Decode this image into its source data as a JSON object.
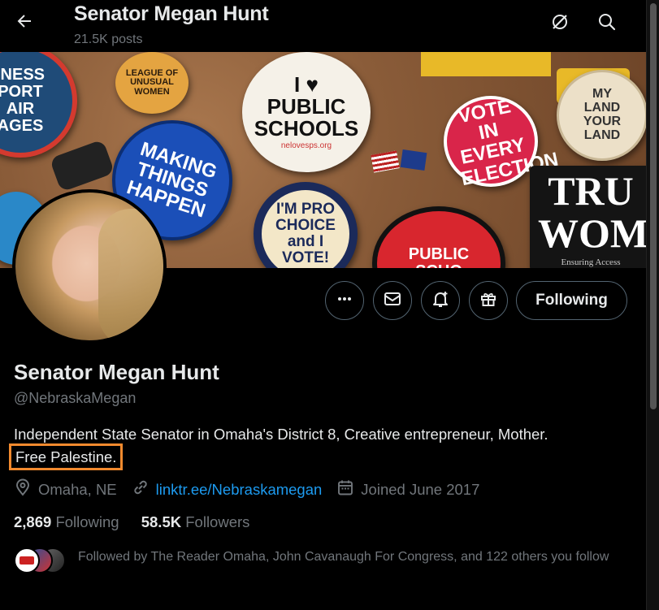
{
  "header": {
    "title": "Senator Megan Hunt",
    "posts": "21.5K posts",
    "back_icon": "arrow-left-icon",
    "icons": [
      "grok-icon",
      "search-icon"
    ]
  },
  "banner": {
    "buttons": [
      {
        "text": "INESS PORT AIR AGES"
      },
      {
        "text": "LEAGUE OF UNUSUAL WOMEN"
      },
      {
        "text": "I ♥ PUBLIC SCHOOLS"
      },
      {
        "text": "nelovesps.org"
      },
      {
        "text": "MAKING THINGS HAPPEN"
      },
      {
        "text": "I'M PRO CHOICE and I VOTE!"
      },
      {
        "text": "PUBLIC SCHO"
      },
      {
        "text": "VOTE IN EVERY ELECTION"
      },
      {
        "text": "MY LAND YOUR LAND"
      },
      {
        "text": "TRU WOM"
      },
      {
        "text": "Ensuring Access"
      }
    ]
  },
  "actions": {
    "following_label": "Following",
    "icons": [
      "more-icon",
      "message-icon",
      "notification-bell-icon",
      "gift-icon"
    ]
  },
  "profile": {
    "name": "Senator Megan Hunt",
    "handle": "@NebraskaMegan",
    "bio_line1": "Independent State Senator in Omaha's District 8, Creative entrepreneur, Mother.",
    "bio_line2": "Free Palestine.",
    "location": "Omaha, NE",
    "link": "linktr.ee/Nebraskamegan",
    "joined": "Joined June 2017",
    "following_count": "2,869",
    "following_label": "Following",
    "followers_count": "58.5K",
    "followers_label": "Followers",
    "followed_by": "Followed by The Reader Omaha, John Cavanaugh For Congress, and 122 others you follow"
  },
  "colors": {
    "accent": "#1d9bf0",
    "highlight": "#f28a2e",
    "muted": "#71767b"
  }
}
